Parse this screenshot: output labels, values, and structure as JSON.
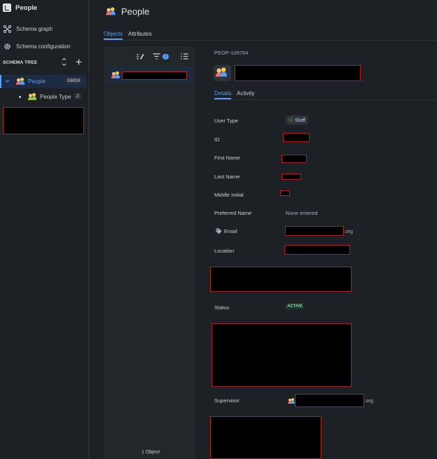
{
  "sidebar": {
    "app_title": "People",
    "nav": [
      {
        "label": "Schema graph",
        "icon": "schema-graph-icon"
      },
      {
        "label": "Schema configuration",
        "icon": "gear-icon"
      }
    ],
    "schema_tree_label": "SCHEMA TREE",
    "tree": {
      "root": {
        "label": "People",
        "count": "59859"
      },
      "children": [
        {
          "label": "People Type",
          "count": "2"
        }
      ]
    }
  },
  "header": {
    "title": "People",
    "tabs": [
      "Objects",
      "Attributes"
    ],
    "active_tab": "Objects"
  },
  "list": {
    "filter_count": "1",
    "footer": "1 Object"
  },
  "detail": {
    "object_key": "PEOP-109764",
    "tabs": [
      "Details",
      "Activity"
    ],
    "active_tab": "Details",
    "fields": {
      "user_type_label": "User Type",
      "user_type_value": "Staff",
      "id_label": "ID",
      "first_name_label": "First Name",
      "last_name_label": "Last Name",
      "middle_initial_label": "Middle Initial",
      "preferred_name_label": "Preferred Name",
      "preferred_name_value": "None entered",
      "email_label": "Email",
      "email_suffix": ".org",
      "location_label": "Location",
      "status_label": "Status",
      "status_value": "ACTIVE",
      "supervisor_label": "Supervisor",
      "supervisor_suffix": ".org"
    }
  },
  "colors": {
    "accent": "#579dff",
    "background": "#1d2125",
    "redaction_border": "#b02020",
    "status_active": "#7ee2b8"
  }
}
